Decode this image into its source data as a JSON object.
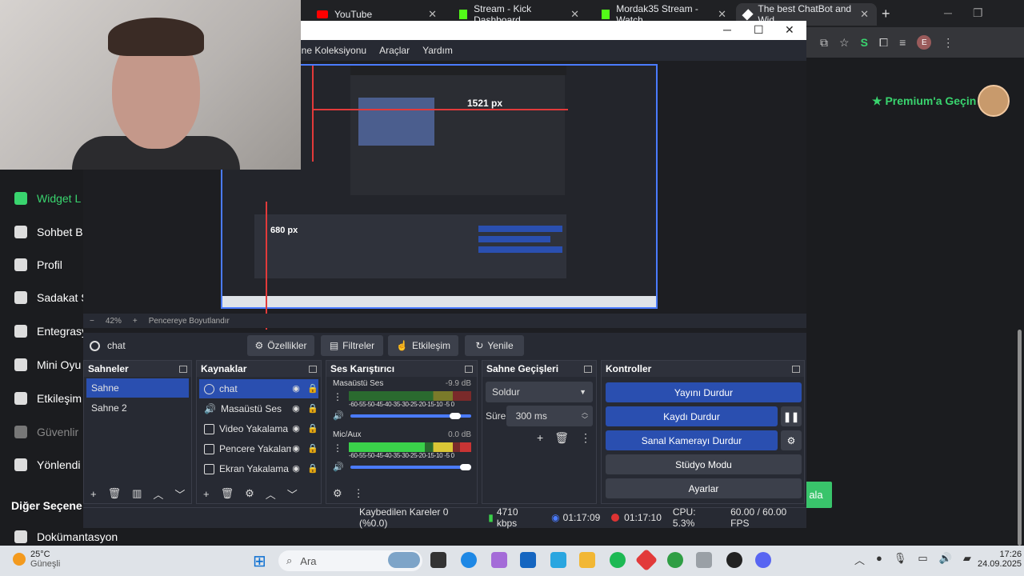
{
  "browser": {
    "tabs": [
      {
        "label": "YouTube",
        "icon": "youtube-icon",
        "color": "#ff0000"
      },
      {
        "label": "Stream - Kick Dashboard",
        "icon": "kick-icon",
        "color": "#53fc18"
      },
      {
        "label": "Mordak35 Stream - Watch",
        "icon": "kick-icon",
        "color": "#53fc18"
      },
      {
        "label": "The best ChatBot and Wid",
        "icon": "botrix-icon",
        "color": "#ffffff"
      }
    ],
    "new_tab": "+",
    "profile_initial": "E"
  },
  "page": {
    "premium_label": "Premium'a Geçin",
    "sidebar": [
      {
        "label": "Widget L",
        "icon": "widget-icon",
        "state": "active"
      },
      {
        "label": "Sohbet B",
        "icon": "robot-icon",
        "state": "normal"
      },
      {
        "label": "Profil",
        "icon": "profile-icon",
        "state": "normal"
      },
      {
        "label": "Sadakat S",
        "icon": "trophy-icon",
        "state": "normal"
      },
      {
        "label": "Entegrasy",
        "icon": "integration-icon",
        "state": "normal"
      },
      {
        "label": "Mini Oyu",
        "icon": "gamepad-icon",
        "state": "normal"
      },
      {
        "label": "Etkileşim",
        "icon": "music-icon",
        "state": "normal"
      },
      {
        "label": "Güvenlir",
        "icon": "shield-icon",
        "state": "dim"
      },
      {
        "label": "Yönlendi",
        "icon": "users-icon",
        "state": "normal"
      }
    ],
    "section_other": "Diğer Seçene",
    "docs_label": "Dokümantasyon",
    "green_button": "ala"
  },
  "obs": {
    "menu": [
      "nne Koleksiyonu",
      "Araçlar",
      "Yardım"
    ],
    "zoom": "42%",
    "fit_label": "Pencereye Boyutlandır",
    "nested_width_label": "1521 px",
    "nested_height_label": "680 px",
    "source_name": "chat",
    "context_buttons": [
      "Özellikler",
      "Filtreler",
      "Etkileşim",
      "Yenile"
    ],
    "docks": {
      "scenes": {
        "title": "Sahneler",
        "items": [
          "Sahne",
          "Sahne 2"
        ],
        "selected": 0
      },
      "sources": {
        "title": "Kaynaklar",
        "items": [
          "chat",
          "Masaüstü Ses",
          "Video Yakalama",
          "Pencere Yakalam",
          "Ekran Yakalama"
        ],
        "selected": 0
      },
      "mixer": {
        "title": "Ses Karıştırıcı",
        "channels": [
          {
            "name": "Masaüstü Ses",
            "db": "-9.9 dB",
            "volume": 0.82
          },
          {
            "name": "Mic/Aux",
            "db": "0.0 dB",
            "volume": 1.0
          }
        ],
        "ticks": "-60-55-50-45-40-35-30-25-20-15-10 -5  0"
      },
      "transitions": {
        "title": "Sahne Geçişleri",
        "type": "Soldur",
        "duration_label": "Süre",
        "duration": "300 ms"
      },
      "controls": {
        "title": "Kontroller",
        "buttons": [
          "Yayını Durdur",
          "Kaydı Durdur",
          "Sanal Kamerayı Durdur",
          "Stüdyo Modu",
          "Ayarlar"
        ]
      }
    },
    "status": {
      "dropped": "Kaybedilen Kareler 0 (%0.0)",
      "bitrate": "4710 kbps",
      "stream_time": "01:17:09",
      "rec_time": "01:17:10",
      "cpu": "CPU: 5.3%",
      "fps": "60.00 / 60.00 FPS"
    }
  },
  "taskbar": {
    "temp": "25°C",
    "weather": "Güneşli",
    "search_placeholder": "Ara",
    "time": "17:26",
    "date": "24.09.2025"
  }
}
